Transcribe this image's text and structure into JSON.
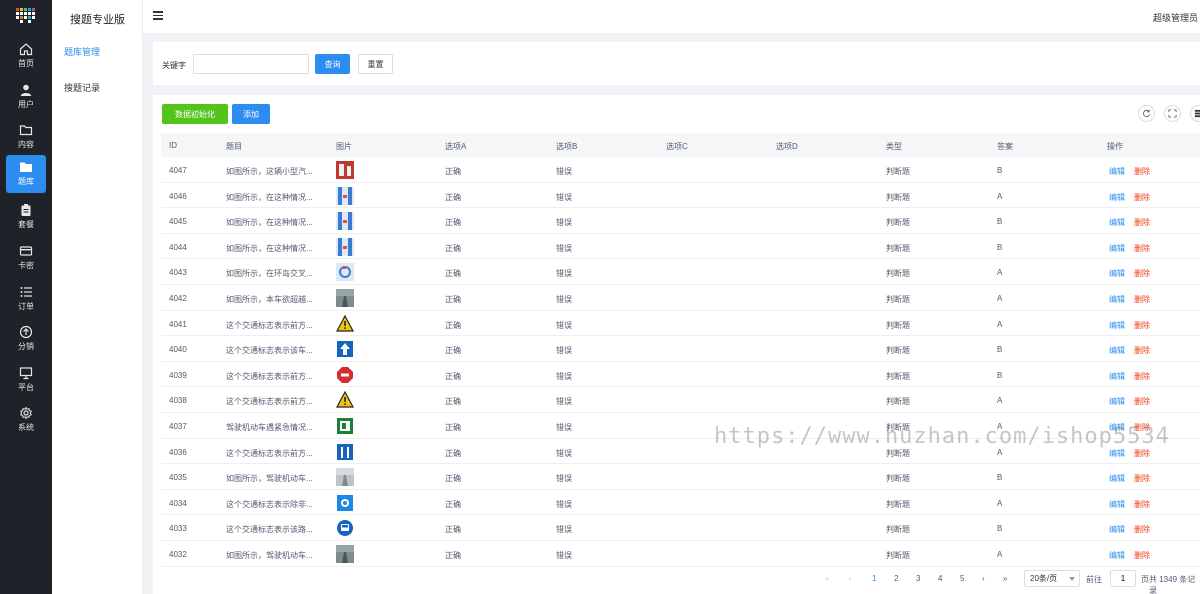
{
  "colors": {
    "primary": "#2d8cf0",
    "success": "#52c41a",
    "danger": "#ed4014",
    "sidebar_bg": "#1f2329"
  },
  "rail": [
    {
      "label": "首页",
      "icon": "home-icon"
    },
    {
      "label": "用户",
      "icon": "user-icon"
    },
    {
      "label": "内容",
      "icon": "folder-outline-icon"
    },
    {
      "label": "题库",
      "icon": "folder-icon",
      "active": true
    },
    {
      "label": "套餐",
      "icon": "clipboard-icon"
    },
    {
      "label": "卡密",
      "icon": "card-icon"
    },
    {
      "label": "订单",
      "icon": "list-icon"
    },
    {
      "label": "分销",
      "icon": "share-icon"
    },
    {
      "label": "平台",
      "icon": "monitor-icon"
    },
    {
      "label": "系统",
      "icon": "gear-icon"
    }
  ],
  "menu": {
    "title": "搜题专业版",
    "items": [
      {
        "label": "题库管理",
        "active": true
      },
      {
        "label": "搜题记录"
      }
    ]
  },
  "header": {
    "user": "超级管理员"
  },
  "search": {
    "label": "关键字",
    "value": "",
    "placeholder": "",
    "query_btn": "查询",
    "reset_btn": "重置"
  },
  "toolbar": {
    "init_btn": "数据初始化",
    "add_btn": "添加"
  },
  "table": {
    "columns": [
      "ID",
      "题目",
      "图片",
      "选项A",
      "选项B",
      "选项C",
      "选项D",
      "类型",
      "答案",
      "操作"
    ],
    "edit_label": "编辑",
    "delete_label": "删除",
    "rows": [
      {
        "id": "4047",
        "title": "如图所示，这辆小型汽...",
        "image": "road-scene",
        "a": "正确",
        "b": "错误",
        "c": "",
        "d": "",
        "type": "判断题",
        "answer": "B"
      },
      {
        "id": "4046",
        "title": "如图所示，在这种情况...",
        "image": "lane-diagram",
        "a": "正确",
        "b": "错误",
        "c": "",
        "d": "",
        "type": "判断题",
        "answer": "A"
      },
      {
        "id": "4045",
        "title": "如图所示，在这种情况...",
        "image": "lane-diagram",
        "a": "正确",
        "b": "错误",
        "c": "",
        "d": "",
        "type": "判断题",
        "answer": "B"
      },
      {
        "id": "4044",
        "title": "如图所示，在这种情况...",
        "image": "lane-diagram",
        "a": "正确",
        "b": "错误",
        "c": "",
        "d": "",
        "type": "判断题",
        "answer": "B"
      },
      {
        "id": "4043",
        "title": "如图所示，在环岛交叉...",
        "image": "roundabout-diagram",
        "a": "正确",
        "b": "错误",
        "c": "",
        "d": "",
        "type": "判断题",
        "answer": "A"
      },
      {
        "id": "4042",
        "title": "如图所示，本车欲超越...",
        "image": "road-photo",
        "a": "正确",
        "b": "错误",
        "c": "",
        "d": "",
        "type": "判断题",
        "answer": "A"
      },
      {
        "id": "4041",
        "title": "这个交通标志表示前方...",
        "image": "warning-sign",
        "a": "正确",
        "b": "错误",
        "c": "",
        "d": "",
        "type": "判断题",
        "answer": "A"
      },
      {
        "id": "4040",
        "title": "这个交通标志表示该车...",
        "image": "arrow-sign",
        "a": "正确",
        "b": "错误",
        "c": "",
        "d": "",
        "type": "判断题",
        "answer": "B"
      },
      {
        "id": "4039",
        "title": "这个交通标志表示前方...",
        "image": "stop-sign",
        "a": "正确",
        "b": "错误",
        "c": "",
        "d": "",
        "type": "判断题",
        "answer": "B"
      },
      {
        "id": "4038",
        "title": "这个交通标志表示前方...",
        "image": "warning-sign",
        "a": "正确",
        "b": "错误",
        "c": "",
        "d": "",
        "type": "判断题",
        "answer": "A"
      },
      {
        "id": "4037",
        "title": "驾驶机动车遇紧急情况...",
        "image": "green-sign",
        "a": "正确",
        "b": "错误",
        "c": "",
        "d": "",
        "type": "判断题",
        "answer": "A"
      },
      {
        "id": "4036",
        "title": "这个交通标志表示前方...",
        "image": "lane-sign",
        "a": "正确",
        "b": "错误",
        "c": "",
        "d": "",
        "type": "判断题",
        "answer": "A"
      },
      {
        "id": "4035",
        "title": "如图所示，驾驶机动车...",
        "image": "road-photo-light",
        "a": "正确",
        "b": "错误",
        "c": "",
        "d": "",
        "type": "判断题",
        "answer": "B"
      },
      {
        "id": "4034",
        "title": "这个交通标志表示除非...",
        "image": "blue-sign",
        "a": "正确",
        "b": "错误",
        "c": "",
        "d": "",
        "type": "判断题",
        "answer": "A"
      },
      {
        "id": "4033",
        "title": "这个交通标志表示该路...",
        "image": "bus-sign",
        "a": "正确",
        "b": "错误",
        "c": "",
        "d": "",
        "type": "判断题",
        "answer": "B"
      },
      {
        "id": "4032",
        "title": "如图所示，驾驶机动车...",
        "image": "road-photo",
        "a": "正确",
        "b": "错误",
        "c": "",
        "d": "",
        "type": "判断题",
        "answer": "A"
      }
    ]
  },
  "pagination": {
    "first": "«",
    "prev": "‹",
    "next": "›",
    "last": "»",
    "pages": [
      "1",
      "2",
      "3",
      "4",
      "5"
    ],
    "current": "1",
    "page_size": "20条/页",
    "goto_label": "前往",
    "goto_value": "1",
    "page_unit": "页",
    "total": "共 1349 条记录"
  },
  "watermark": "https://www.huzhan.com/ishop5534"
}
